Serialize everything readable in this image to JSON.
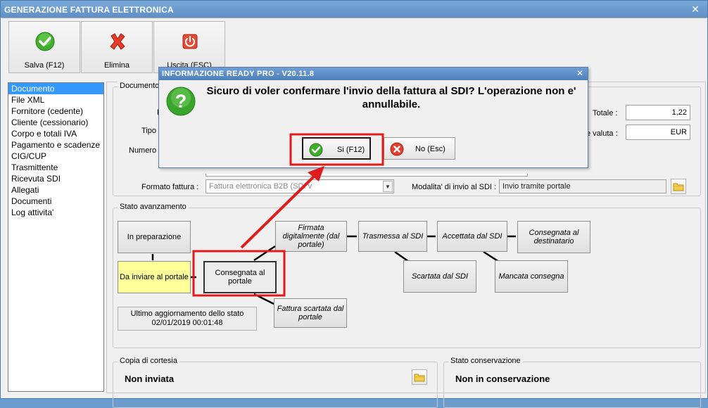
{
  "window": {
    "title": "GENERAZIONE FATTURA ELETTRONICA",
    "close_glyph": "✕"
  },
  "toolbar": {
    "save_label": "Salva (F12)",
    "delete_label": "Elimina",
    "exit_label": "Uscita (ESC)"
  },
  "sidebar": {
    "items": [
      {
        "label": "Documento",
        "selected": true
      },
      {
        "label": "File XML"
      },
      {
        "label": "Fornitore (cedente)"
      },
      {
        "label": "Cliente (cessionario)"
      },
      {
        "label": "Corpo e totali IVA"
      },
      {
        "label": "Pagamento e scadenze"
      },
      {
        "label": "CIG/CUP"
      },
      {
        "label": "Trasmittente"
      },
      {
        "label": "Ricevuta SDI"
      },
      {
        "label": "Allegati"
      },
      {
        "label": "Documenti"
      },
      {
        "label": "Log attivita'"
      }
    ]
  },
  "documento": {
    "legend": "Documento",
    "label_d": "D",
    "label_tipo": "Tipo d",
    "label_numero": "Numero d",
    "totale_label": "Totale :",
    "totale_value": "1,22",
    "valuta_label": "e valuta :",
    "valuta_value": "EUR",
    "formato_label": "Formato fattura :",
    "formato_value": "Fattura elettronica B2B (SDI v",
    "modalita_label": "Modalita' di invio al SDI :",
    "modalita_value": "Invio tramite portale"
  },
  "stato": {
    "legend": "Stato avanzamento",
    "nodes": {
      "in_preparazione": "In preparazione",
      "da_inviare": "Da inviare al portale",
      "consegnata_portale": "Consegnata al portale",
      "firmata": "Firmata digitalmente (dal portale)",
      "fattura_scartata_portale": "Fattura scartata dal portale",
      "trasmessa": "Trasmessa al SDI",
      "scartata_sdi": "Scartata dal SDI",
      "accettata": "Accettata dal SDI",
      "consegnata_dest": "Consegnata al destinatario",
      "mancata": "Mancata consegna"
    },
    "ultimo_label": "Ultimo aggiornamento dello stato",
    "ultimo_value": "02/01/2019 00:01:48"
  },
  "copia": {
    "legend": "Copia di cortesia",
    "value": "Non inviata"
  },
  "conservazione": {
    "legend": "Stato conservazione",
    "value": "Non in conservazione"
  },
  "dialog": {
    "title": "INFORMAZIONE READY PRO - V20.11.8",
    "message": "Sicuro di voler confermare l'invio della fattura al SDI? L'operazione non e' annullabile.",
    "yes_label": "Si (F12)",
    "no_label": "No (Esc)",
    "close_glyph": "✕"
  },
  "colors": {
    "highlight": "#e01b1b",
    "selection": "#3399ff",
    "yellow_state": "#ffff99",
    "titlebar": "#6b9ed3"
  }
}
